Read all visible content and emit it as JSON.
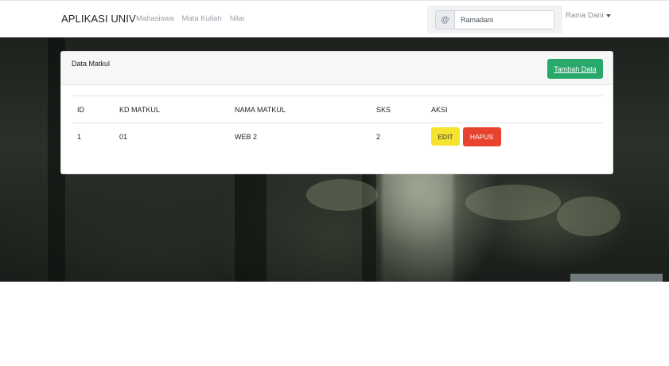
{
  "navbar": {
    "brand": "APLIKASI UNIV",
    "links": [
      "Mahasiswa",
      "Mata Kuliah",
      "Nilai"
    ],
    "search": {
      "addon_icon": "at-icon",
      "addon_text": "@",
      "value": "Ramadani"
    },
    "user": {
      "name": "Rama Dani",
      "icon": "caret-down-icon"
    }
  },
  "card": {
    "title": "Data Matkul",
    "add_button": "Tambah Data",
    "table": {
      "headers": [
        "ID",
        "KD MATKUL",
        "NAMA MATKUL",
        "SKS",
        "AKSI"
      ],
      "rows": [
        {
          "id": "1",
          "kd_matkul": "01",
          "nama_matkul": "WEB 2",
          "sks": "2",
          "edit_label": "EDIT",
          "delete_label": "HAPUS"
        }
      ]
    }
  },
  "colors": {
    "add_button": "#28a86b",
    "edit_button": "#f5e330",
    "delete_button": "#e8432f",
    "navbar_bg": "#ffffff"
  }
}
